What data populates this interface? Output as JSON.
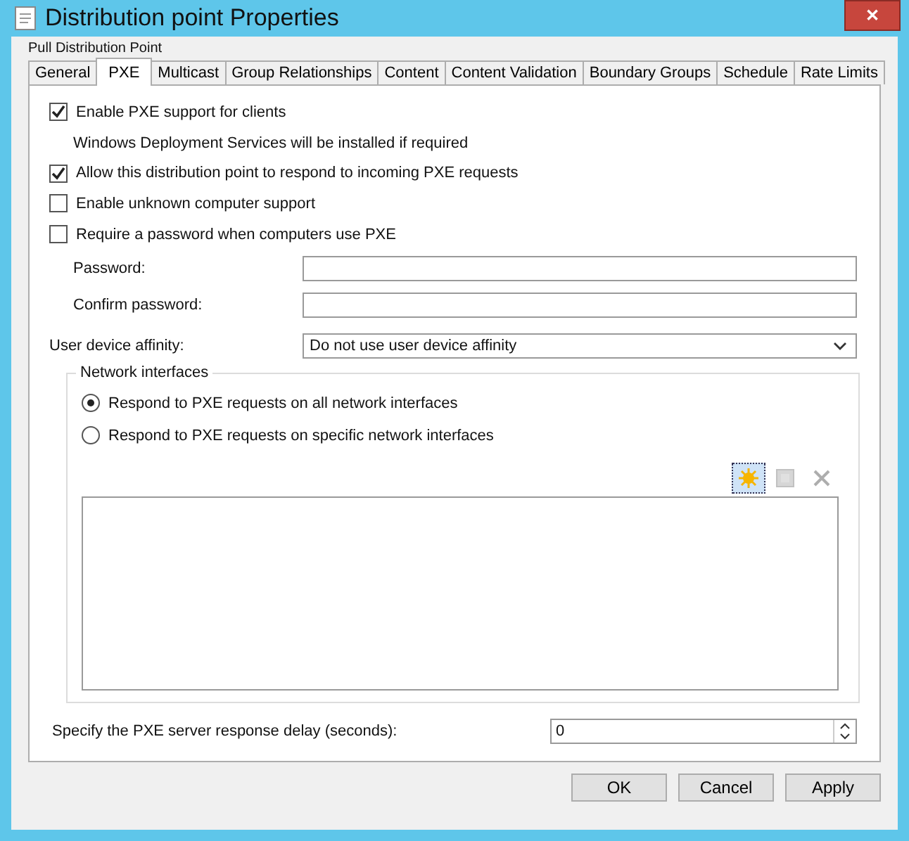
{
  "window": {
    "title": "Distribution point Properties",
    "subtitle": "Pull Distribution Point",
    "close": "✕"
  },
  "tabs": [
    {
      "label": "General",
      "selected": false
    },
    {
      "label": "PXE",
      "selected": true
    },
    {
      "label": "Multicast",
      "selected": false
    },
    {
      "label": "Group Relationships",
      "selected": false
    },
    {
      "label": "Content",
      "selected": false
    },
    {
      "label": "Content Validation",
      "selected": false
    },
    {
      "label": "Boundary Groups",
      "selected": false
    },
    {
      "label": "Schedule",
      "selected": false
    },
    {
      "label": "Rate Limits",
      "selected": false
    }
  ],
  "options": [
    {
      "kind": "checkbox",
      "label": "Enable PXE support for clients",
      "checked": true
    },
    {
      "kind": "note",
      "label": "Windows Deployment Services will be installed if required"
    },
    {
      "kind": "checkbox",
      "label": "Allow this distribution point to respond to incoming PXE requests",
      "checked": true
    },
    {
      "kind": "checkbox",
      "label": "Enable unknown computer support",
      "checked": false
    },
    {
      "kind": "checkbox",
      "label": "Require a password when computers use PXE",
      "checked": false
    }
  ],
  "password_fields": [
    {
      "label": "Password:"
    },
    {
      "label": "Confirm password:"
    }
  ],
  "affinity": {
    "label": "User device affinity:",
    "value": "Do not use user device affinity"
  },
  "network_interfaces": {
    "title": "Network interfaces",
    "radios": [
      {
        "label": "Respond to PXE requests on all network interfaces",
        "selected": true
      },
      {
        "label": "Respond to PXE requests on specific network interfaces",
        "selected": false
      }
    ],
    "toolbar": [
      {
        "kind": "new",
        "disabled": false
      },
      {
        "kind": "properties",
        "disabled": true
      },
      {
        "kind": "delete",
        "disabled": true
      }
    ]
  },
  "delay": {
    "label": "Specify the PXE server response delay (seconds):",
    "value": "0"
  },
  "buttons": [
    "OK",
    "Cancel",
    "Apply"
  ]
}
